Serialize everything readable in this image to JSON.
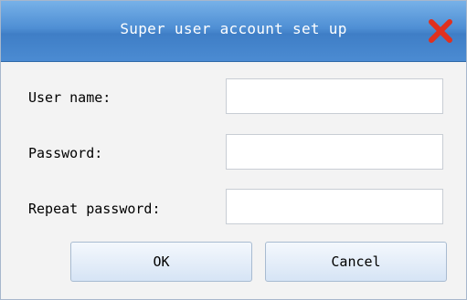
{
  "dialog": {
    "title": "Super user account set up",
    "close_icon": "close-x-icon",
    "close_color": "#e0301e"
  },
  "form": {
    "username_label": "User name:",
    "username_value": "",
    "password_label": "Password:",
    "password_value": "",
    "repeat_label": "Repeat password:",
    "repeat_value": ""
  },
  "buttons": {
    "ok_label": "OK",
    "cancel_label": "Cancel"
  }
}
